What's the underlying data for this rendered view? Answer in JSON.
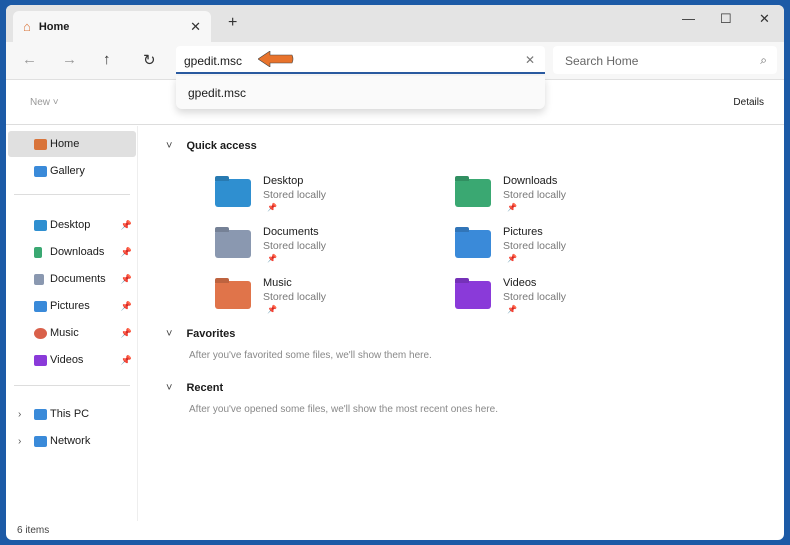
{
  "tab": {
    "title": "Home",
    "close": "✕",
    "new_tab": "+"
  },
  "window_controls": {
    "minimize": "—",
    "maximize": "☐",
    "close": "✕"
  },
  "nav": {
    "back": "←",
    "forward": "→",
    "up": "↑",
    "refresh": "↻"
  },
  "address": {
    "value": "gpedit.msc",
    "clear": "✕",
    "suggestion": "gpedit.msc"
  },
  "search": {
    "placeholder": "Search Home",
    "icon": "⌕"
  },
  "command_bar": {
    "new": "New ˅",
    "details": "Details"
  },
  "sidebar": {
    "top": [
      {
        "label": "Home",
        "color": "#d9743a"
      },
      {
        "label": "Gallery",
        "color": "#3a8ad9"
      }
    ],
    "pinned": [
      {
        "label": "Desktop",
        "color": "#2f8fd0"
      },
      {
        "label": "Downloads",
        "color": "#3aa872"
      },
      {
        "label": "Documents",
        "color": "#8a98b0"
      },
      {
        "label": "Pictures",
        "color": "#3a8ad9"
      },
      {
        "label": "Music",
        "color": "#d9604a"
      },
      {
        "label": "Videos",
        "color": "#8a3ad9"
      }
    ],
    "pin_glyph": "📌",
    "bottom": [
      {
        "label": "This PC"
      },
      {
        "label": "Network"
      }
    ]
  },
  "sections": {
    "quick_access": "Quick access",
    "favorites": "Favorites",
    "favorites_empty": "After you've favorited some files, we'll show them here.",
    "recent": "Recent",
    "recent_empty": "After you've opened some files, we'll show the most recent ones here."
  },
  "quick_access": [
    {
      "name": "Desktop",
      "status": "Stored locally",
      "color": "#2f8fd0"
    },
    {
      "name": "Downloads",
      "status": "Stored locally",
      "color": "#3aa872"
    },
    {
      "name": "Documents",
      "status": "Stored locally",
      "color": "#8a98b0"
    },
    {
      "name": "Pictures",
      "status": "Stored locally",
      "color": "#3a8ad9"
    },
    {
      "name": "Music",
      "status": "Stored locally",
      "color": "#e0744a"
    },
    {
      "name": "Videos",
      "status": "Stored locally",
      "color": "#8a3ad9"
    }
  ],
  "status": {
    "items": "6 items"
  }
}
